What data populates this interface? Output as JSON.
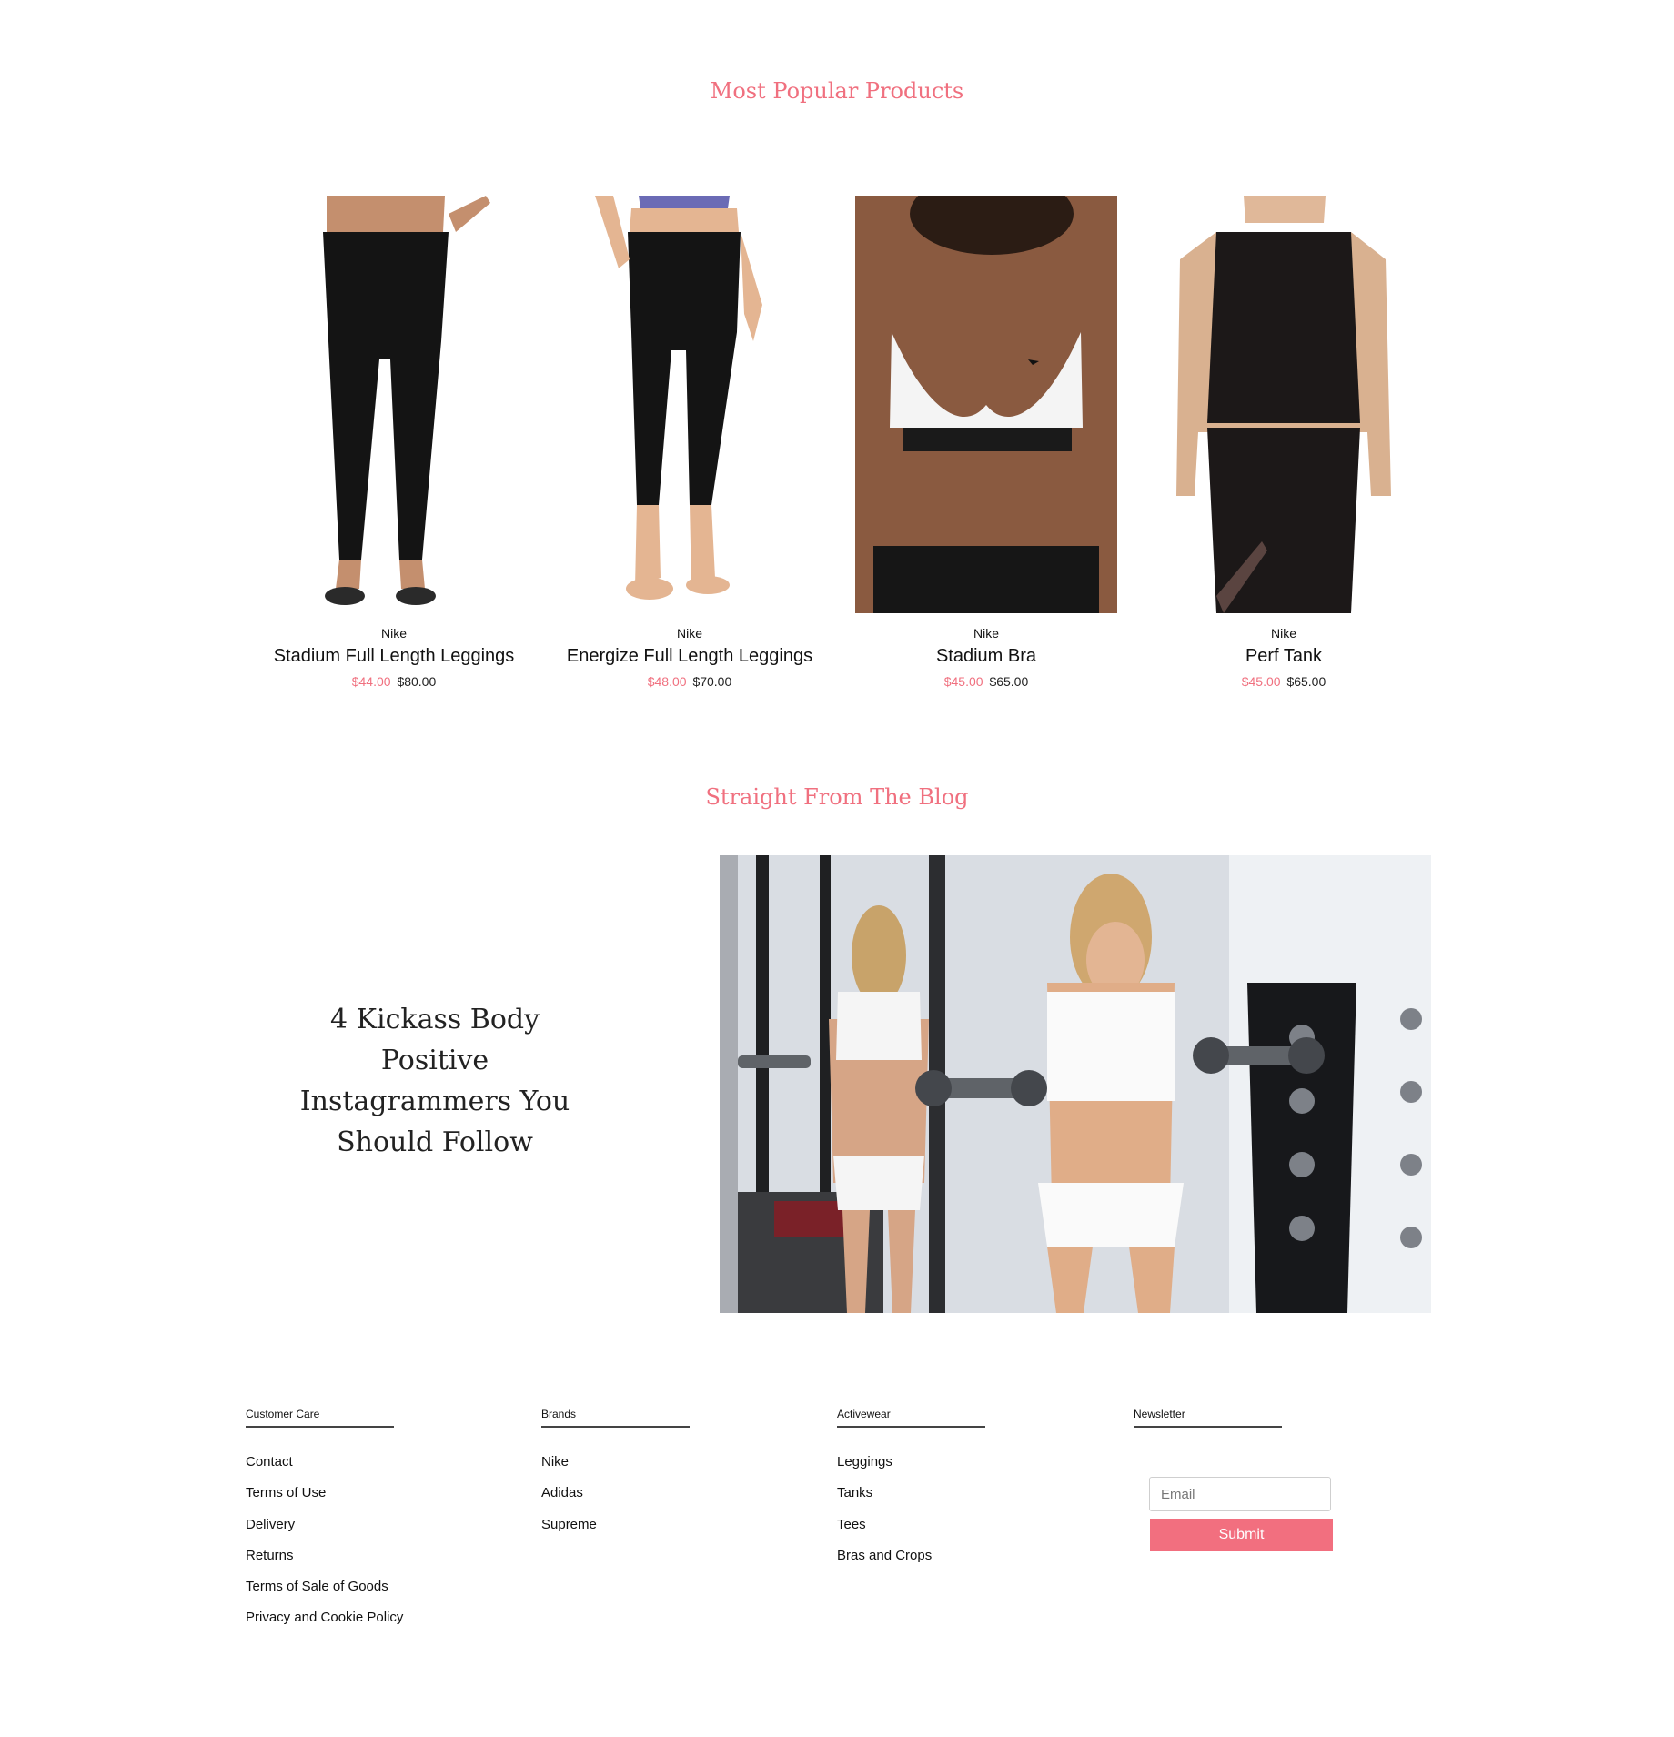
{
  "sections": {
    "popular_title": "Most Popular Products",
    "blog_title": "Straight From The Blog"
  },
  "products": [
    {
      "brand": "Nike",
      "name": "Stadium Full Length Leggings",
      "sale_price": "$44.00",
      "original_price": "$80.00"
    },
    {
      "brand": "Nike",
      "name": "Energize Full Length Leggings",
      "sale_price": "$48.00",
      "original_price": "$70.00"
    },
    {
      "brand": "Nike",
      "name": "Stadium Bra",
      "sale_price": "$45.00",
      "original_price": "$65.00"
    },
    {
      "brand": "Nike",
      "name": "Perf Tank",
      "sale_price": "$45.00",
      "original_price": "$65.00"
    }
  ],
  "blog": {
    "headline": "4 Kickass Body Positive Instagrammers You Should Follow"
  },
  "footer": {
    "customer_care": {
      "title": "Customer Care",
      "links": [
        "Contact",
        "Terms of Use",
        "Delivery",
        "Returns",
        "Terms of Sale of Goods",
        "Privacy and Cookie Policy"
      ]
    },
    "brands": {
      "title": "Brands",
      "links": [
        "Nike",
        "Adidas",
        "Supreme"
      ]
    },
    "activewear": {
      "title": "Activewear",
      "links": [
        "Leggings",
        "Tanks",
        "Tees",
        "Bras and Crops"
      ]
    },
    "newsletter": {
      "title": "Newsletter",
      "email_placeholder": "Email",
      "submit_label": "Submit"
    }
  },
  "colors": {
    "accent": "#f0707f",
    "text": "#111111"
  }
}
